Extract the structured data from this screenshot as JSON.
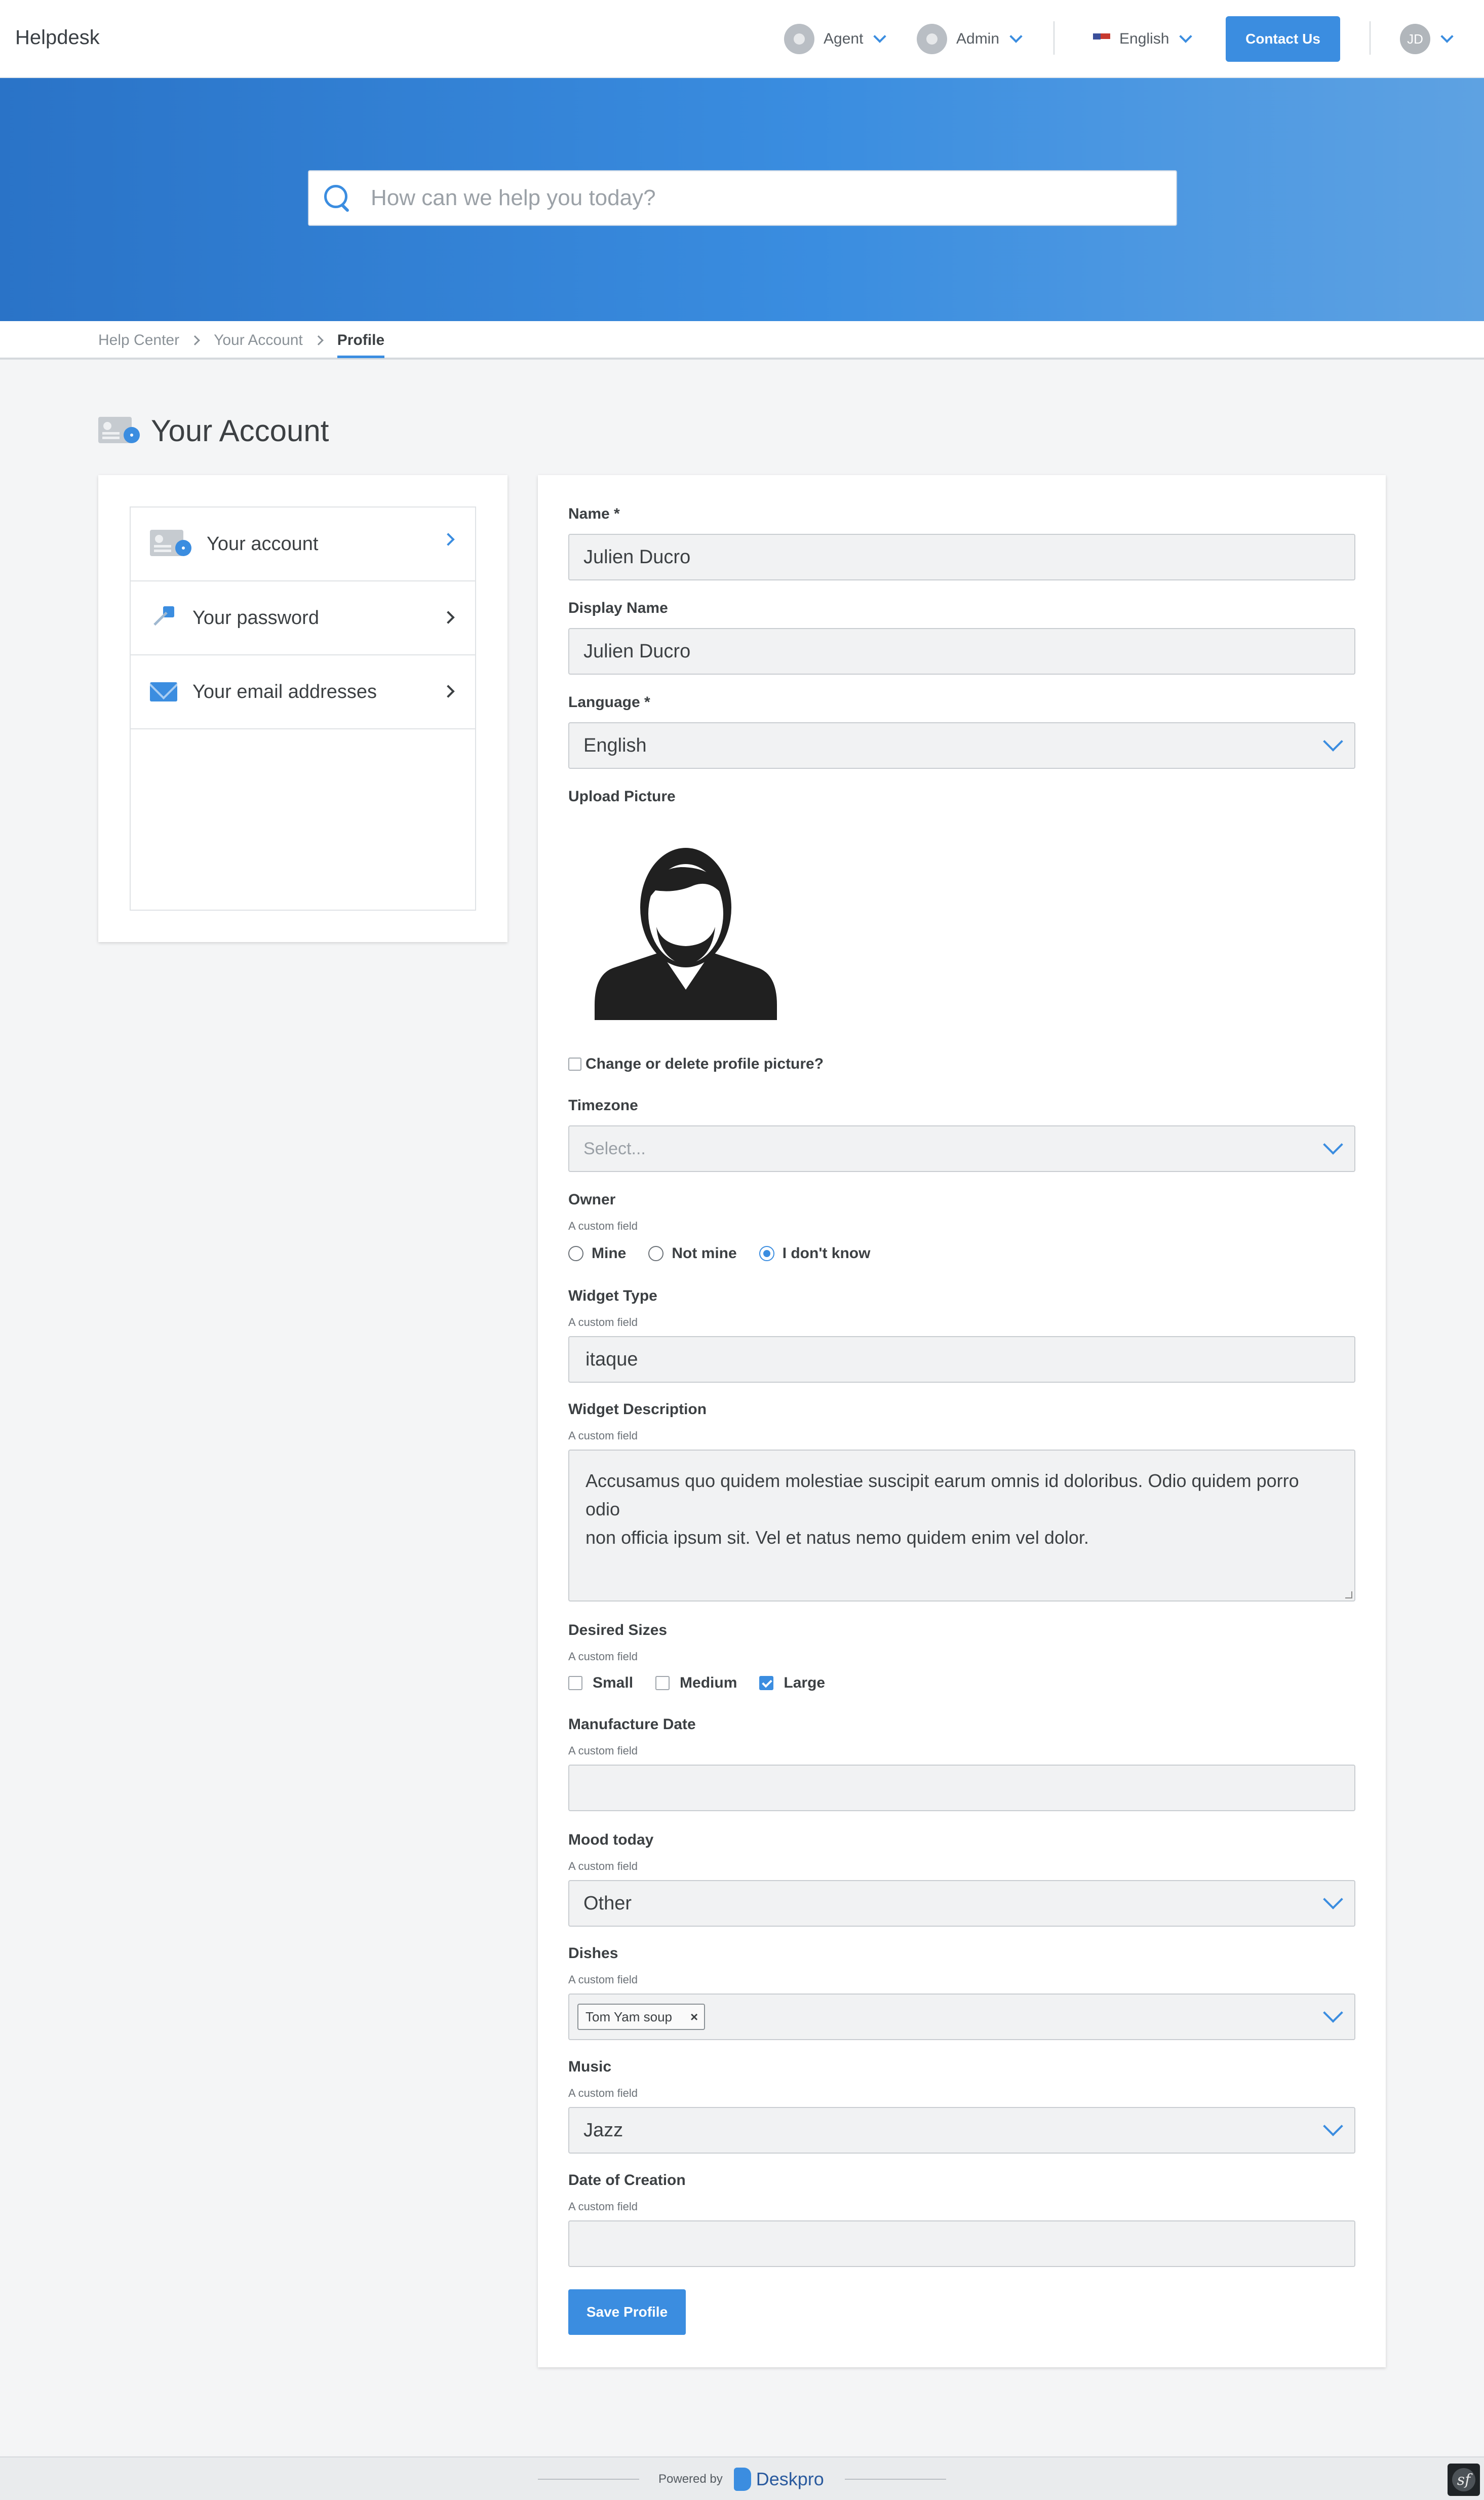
{
  "header": {
    "brand": "Helpdesk",
    "agent_label": "Agent",
    "admin_label": "Admin",
    "language_label": "English",
    "contact_button": "Contact Us",
    "user_initials": "JD"
  },
  "hero": {
    "search_placeholder": "How can we help you today?"
  },
  "breadcrumb": {
    "items": [
      "Help Center",
      "Your Account",
      "Profile"
    ]
  },
  "page": {
    "title": "Your Account"
  },
  "sidebar": {
    "items": [
      {
        "label": "Your account",
        "icon": "account-card-icon"
      },
      {
        "label": "Your password",
        "icon": "key-icon"
      },
      {
        "label": "Your email addresses",
        "icon": "envelope-icon"
      }
    ]
  },
  "form": {
    "name": {
      "label": "Name *",
      "value": "Julien Ducro"
    },
    "display_name": {
      "label": "Display Name",
      "value": "Julien Ducro"
    },
    "language": {
      "label": "Language *",
      "value": "English"
    },
    "upload_picture": {
      "label": "Upload Picture"
    },
    "change_picture": {
      "label": "Change or delete profile picture?",
      "checked": false
    },
    "timezone": {
      "label": "Timezone",
      "placeholder": "Select..."
    },
    "owner": {
      "label": "Owner",
      "sub": "A custom field",
      "options": [
        "Mine",
        "Not mine",
        "I don't know"
      ],
      "selected": "I don't know"
    },
    "widget_type": {
      "label": "Widget Type",
      "sub": "A custom field",
      "value": "itaque"
    },
    "widget_description": {
      "label": "Widget Description",
      "sub": "A custom field",
      "value_line1": "Accusamus quo quidem molestiae suscipit earum omnis id doloribus. Odio quidem porro odio",
      "value_line2": "non officia ipsum sit. Vel et natus nemo quidem enim vel dolor."
    },
    "desired_sizes": {
      "label": "Desired Sizes",
      "sub": "A custom field",
      "options": [
        "Small",
        "Medium",
        "Large"
      ],
      "checked": [
        "Large"
      ]
    },
    "manufacture_date": {
      "label": "Manufacture Date",
      "sub": "A custom field",
      "value": ""
    },
    "mood_today": {
      "label": "Mood today",
      "sub": "A custom field",
      "value": "Other"
    },
    "dishes": {
      "label": "Dishes",
      "sub": "A custom field",
      "tags": [
        "Tom Yam soup"
      ],
      "remove_glyph": "×"
    },
    "music": {
      "label": "Music",
      "sub": "A custom field",
      "value": "Jazz"
    },
    "date_of_creation": {
      "label": "Date of Creation",
      "sub": "A custom field",
      "value": ""
    },
    "save_button": "Save Profile"
  },
  "footer": {
    "powered_by": "Powered by",
    "brand": "Deskpro",
    "debug_badge": "sf"
  },
  "colors": {
    "accent": "#3b8de0",
    "hero_start": "#2a73c7",
    "hero_end": "#5ea2e2"
  }
}
